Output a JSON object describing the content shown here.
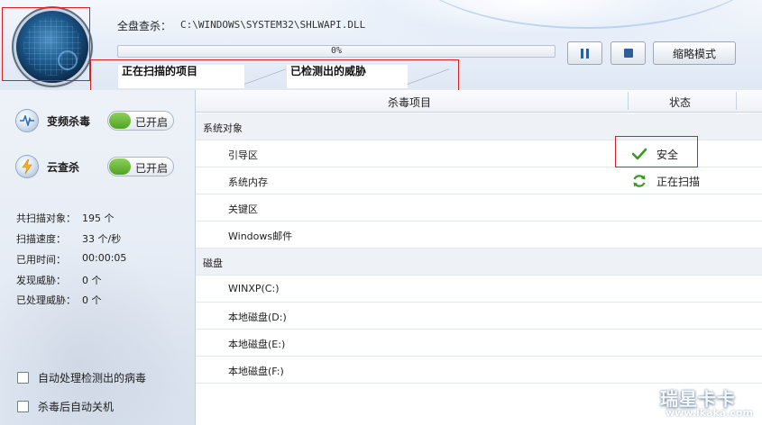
{
  "header": {
    "scan_label": "全盘查杀：",
    "scan_path": "C:\\WINDOWS\\SYSTEM32\\SHLWAPI.DLL",
    "progress_text": "0%",
    "progress_value": 0,
    "pause_icon": "pause-icon",
    "stop_icon": "stop-icon",
    "mini_mode_label": "缩略模式"
  },
  "tabs": [
    {
      "label": "正在扫描的项目"
    },
    {
      "label": "已检测出的威胁"
    }
  ],
  "sidebar": {
    "features": [
      {
        "label": "变频杀毒",
        "toggle": "已开启",
        "icon": "pulse-icon"
      },
      {
        "label": "云查杀",
        "toggle": "已开启",
        "icon": "lightning-icon"
      }
    ],
    "stats": [
      {
        "label": "共扫描对象：",
        "value": "195  个"
      },
      {
        "label": "扫描速度：",
        "value": "33  个/秒"
      },
      {
        "label": "已用时间：",
        "value": "00:00:05"
      },
      {
        "label": "发现威胁：",
        "value": "0  个"
      },
      {
        "label": "已处理威胁：",
        "value": "0  个"
      }
    ],
    "options": [
      {
        "label": "自动处理检测出的病毒",
        "checked": false
      },
      {
        "label": "杀毒后自动关机",
        "checked": false
      }
    ]
  },
  "table": {
    "columns": [
      "杀毒项目",
      "状态"
    ],
    "rows": [
      {
        "type": "group",
        "name": "系统对象",
        "status": ""
      },
      {
        "type": "item",
        "name": "引导区",
        "status": "安全",
        "status_icon": "check-icon"
      },
      {
        "type": "item",
        "name": "系统内存",
        "status": "正在扫描",
        "status_icon": "refresh-icon"
      },
      {
        "type": "item",
        "name": "关键区",
        "status": ""
      },
      {
        "type": "item",
        "name": "Windows邮件",
        "status": ""
      },
      {
        "type": "group",
        "name": "磁盘",
        "status": ""
      },
      {
        "type": "item",
        "name": "WINXP(C:)",
        "status": ""
      },
      {
        "type": "item",
        "name": "本地磁盘(D:)",
        "status": ""
      },
      {
        "type": "item",
        "name": "本地磁盘(E:)",
        "status": ""
      },
      {
        "type": "item",
        "name": "本地磁盘(F:)",
        "status": ""
      }
    ]
  },
  "watermark": {
    "logo": "瑞星卡卡",
    "url": "www.ikaka.com"
  },
  "colors": {
    "accent_blue": "#2f5e9c",
    "toggle_green": "#4fa324",
    "safe_green": "#3a9a1f",
    "highlight_red": "#d8201f"
  }
}
